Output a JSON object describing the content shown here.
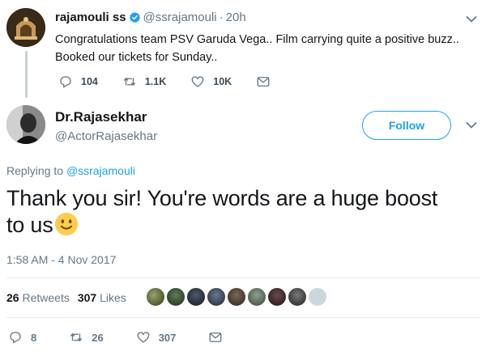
{
  "parent_tweet": {
    "display_name": "rajamouli ss",
    "handle": "@ssrajamouli",
    "time": "20h",
    "separator": "·",
    "text_line1": "Congratulations team PSV Garuda Vega.. Film carrying quite a positive buzz..",
    "text_line2": "Booked our tickets for Sunday..",
    "reply_count": "104",
    "retweet_count": "1.1K",
    "like_count": "10K",
    "verified": true
  },
  "main_tweet": {
    "display_name": "Dr.Rajasekhar",
    "handle": "@ActorRajasekhar",
    "follow_label": "Follow",
    "replying_prefix": "Replying to",
    "replying_to": "@ssrajamouli",
    "text_line1": "Thank you sir! You're words are a huge boost",
    "text_line2": "to us",
    "emoji": "slightly-smiling-face",
    "timestamp": "1:58 AM - 4 Nov 2017",
    "retweets_count": "26",
    "retweets_label": "Retweets",
    "likes_count": "307",
    "likes_label": "Likes",
    "reply_count": "8",
    "retweet_count": "26",
    "like_count": "307"
  },
  "colors": {
    "accent": "#1da1f2",
    "muted": "#657786",
    "text": "#14171a",
    "divider": "#e6ecf0"
  },
  "icons": [
    "verified-badge-icon",
    "reply-icon",
    "retweet-icon",
    "like-icon",
    "direct-message-icon",
    "chevron-down-icon"
  ]
}
